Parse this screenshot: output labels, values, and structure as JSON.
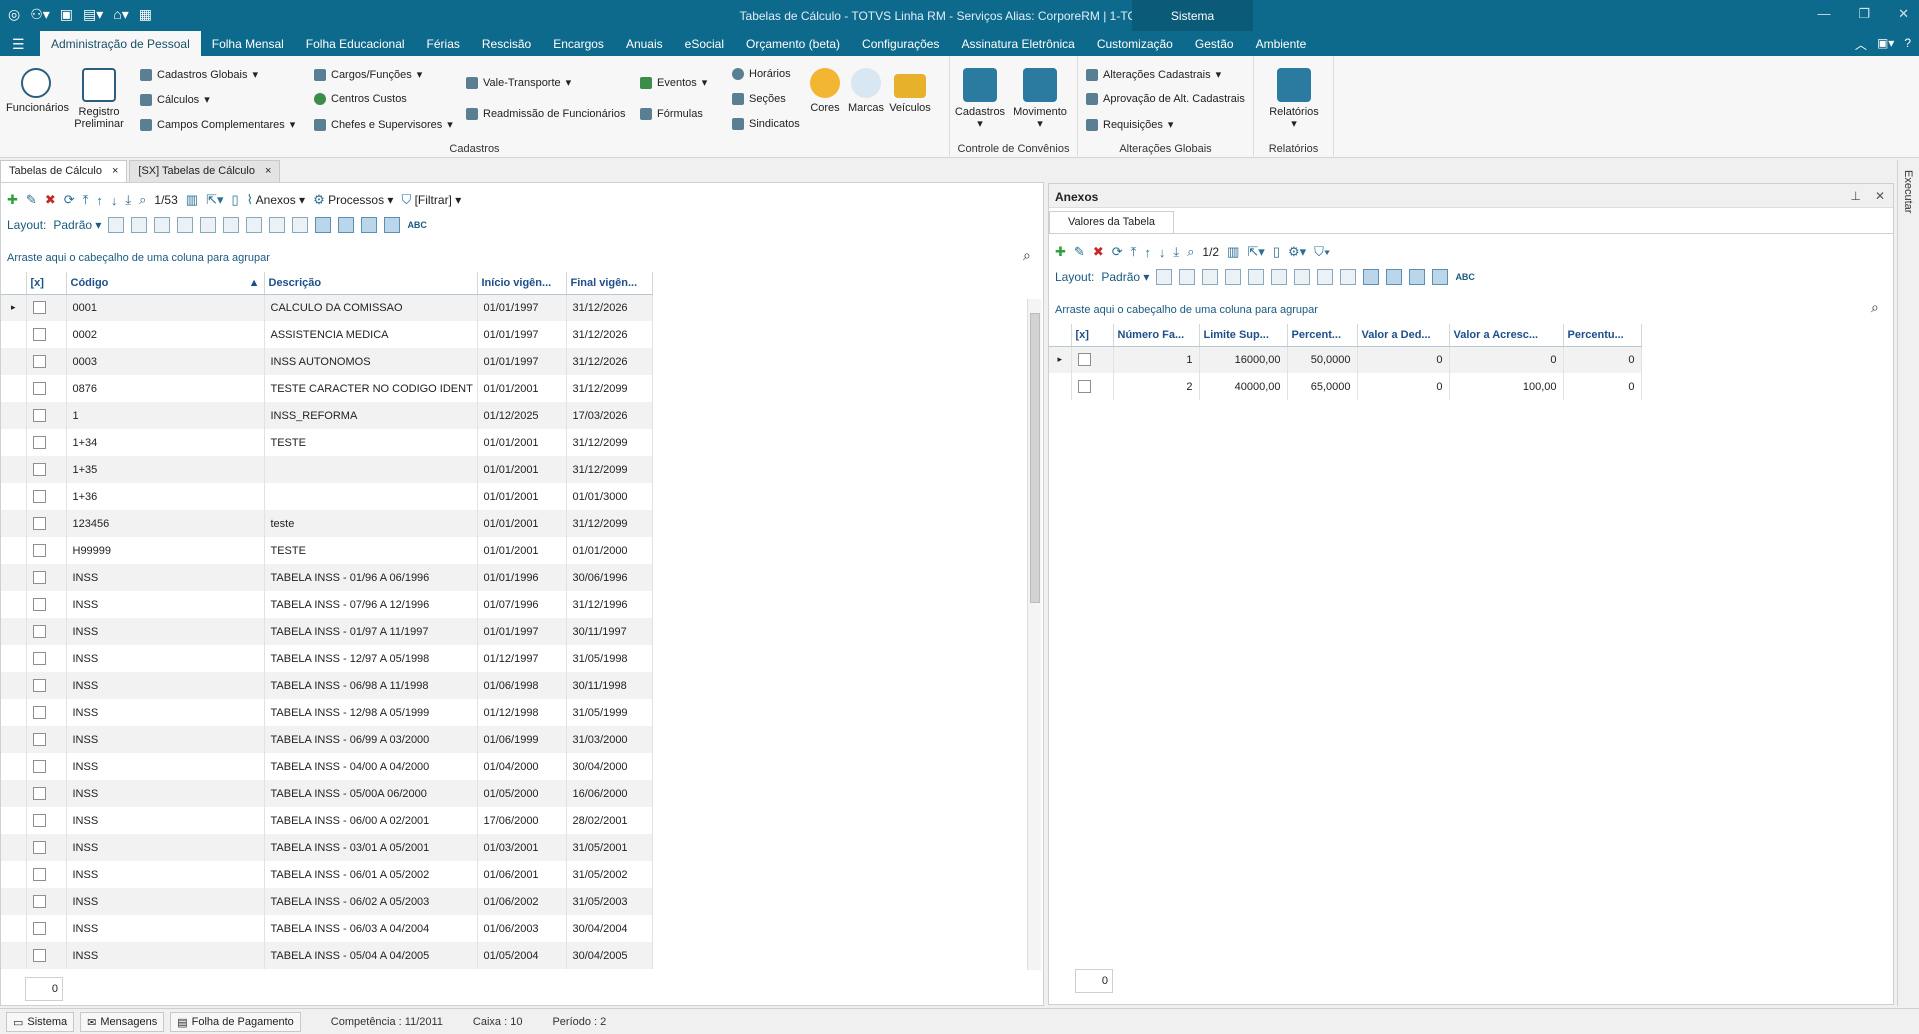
{
  "titlebar": {
    "title": "Tabelas de Cálculo - TOTVS Linha RM - Serviços  Alias: CorporeRM | 1-TOTVS SA",
    "system_tab": "Sistema"
  },
  "menu": {
    "tabs": [
      "Administração de Pessoal",
      "Folha Mensal",
      "Folha Educacional",
      "Férias",
      "Rescisão",
      "Encargos",
      "Anuais",
      "eSocial",
      "Orçamento (beta)",
      "Configurações",
      "Assinatura Eletrônica",
      "Customização",
      "Gestão",
      "Ambiente"
    ],
    "active_index": 0
  },
  "ribbon": {
    "cadastros": {
      "label": "Cadastros",
      "funcionarios": "Funcionários",
      "registro": "Registro Preliminar",
      "cadastros_globais": "Cadastros Globais",
      "calculos": "Cálculos",
      "campos_complementares": "Campos Complementares",
      "cargos": "Cargos/Funções",
      "centros_custos": "Centros Custos",
      "chefes": "Chefes e Supervisores",
      "vale_transporte": "Vale-Transporte",
      "readmissao": "Readmissão de Funcionários",
      "eventos": "Eventos",
      "formulas": "Fórmulas",
      "horarios": "Horários",
      "secoes": "Seções",
      "sindicatos": "Sindicatos",
      "cores": "Cores",
      "marcas": "Marcas",
      "veiculos": "Veículos"
    },
    "convenios": {
      "label": "Controle de Convênios",
      "cadastros": "Cadastros",
      "movimento": "Movimento"
    },
    "alteracoes": {
      "label": "Alterações Globais",
      "alteracoes_cadastrais": "Alterações Cadastrais",
      "aprovacao": "Aprovação de Alt. Cadastrais",
      "requisicoes": "Requisições"
    },
    "relatorios": {
      "label": "Relatórios",
      "button": "Relatórios"
    }
  },
  "doc_tabs": [
    "Tabelas de Cálculo",
    "[SX] Tabelas de Cálculo"
  ],
  "left": {
    "toolbar": {
      "page": "1/53",
      "anexos": "Anexos",
      "processos": "Processos",
      "filtrar": "[Filtrar]"
    },
    "layout_label": "Layout:",
    "layout_value": "Padrão",
    "group_hint": "Arraste aqui o cabeçalho de uma coluna para agrupar",
    "columns": [
      "[x]",
      "Código",
      "Descrição",
      "Início vigên...",
      "Final vigên..."
    ],
    "rows": [
      [
        "0001",
        "CALCULO DA COMISSAO",
        "01/01/1997",
        "31/12/2026"
      ],
      [
        "0002",
        "ASSISTENCIA MEDICA",
        "01/01/1997",
        "31/12/2026"
      ],
      [
        "0003",
        "INSS AUTONOMOS",
        "01/01/1997",
        "31/12/2026"
      ],
      [
        "0876",
        "TESTE CARACTER NO CODIGO IDENT",
        "01/01/2001",
        "31/12/2099"
      ],
      [
        "1",
        "INSS_REFORMA",
        "01/12/2025",
        "17/03/2026"
      ],
      [
        "1+34",
        "TESTE",
        "01/01/2001",
        "31/12/2099"
      ],
      [
        "1+35",
        "",
        "01/01/2001",
        "31/12/2099"
      ],
      [
        "1+36",
        "",
        "01/01/2001",
        "01/01/3000"
      ],
      [
        "123456",
        "teste",
        "01/01/2001",
        "31/12/2099"
      ],
      [
        "H99999",
        "TESTE",
        "01/01/2001",
        "01/01/2000"
      ],
      [
        "INSS",
        "TABELA INSS - 01/96 A 06/1996",
        "01/01/1996",
        "30/06/1996"
      ],
      [
        "INSS",
        "TABELA INSS - 07/96 A 12/1996",
        "01/07/1996",
        "31/12/1996"
      ],
      [
        "INSS",
        "TABELA INSS - 01/97 A 11/1997",
        "01/01/1997",
        "30/11/1997"
      ],
      [
        "INSS",
        "TABELA INSS - 12/97 A 05/1998",
        "01/12/1997",
        "31/05/1998"
      ],
      [
        "INSS",
        "TABELA INSS - 06/98 A 11/1998",
        "01/06/1998",
        "30/11/1998"
      ],
      [
        "INSS",
        "TABELA INSS - 12/98 A  05/1999",
        "01/12/1998",
        "31/05/1999"
      ],
      [
        "INSS",
        "TABELA INSS - 06/99 A 03/2000",
        "01/06/1999",
        "31/03/2000"
      ],
      [
        "INSS",
        "TABELA INSS - 04/00 A  04/2000",
        "01/04/2000",
        "30/04/2000"
      ],
      [
        "INSS",
        "TABELA INSS - 05/00A  06/2000",
        "01/05/2000",
        "16/06/2000"
      ],
      [
        "INSS",
        "TABELA INSS - 06/00 A 02/2001",
        "17/06/2000",
        "28/02/2001"
      ],
      [
        "INSS",
        "TABELA INSS - 03/01 A 05/2001",
        "01/03/2001",
        "31/05/2001"
      ],
      [
        "INSS",
        "TABELA INSS - 06/01 A 05/2002",
        "01/06/2001",
        "31/05/2002"
      ],
      [
        "INSS",
        "TABELA INSS - 06/02 A 05/2003",
        "01/06/2002",
        "31/05/2003"
      ],
      [
        "INSS",
        "TABELA INSS - 06/03 A 04/2004",
        "01/06/2003",
        "30/04/2004"
      ],
      [
        "INSS",
        "TABELA INSS - 05/04 A 04/2005",
        "01/05/2004",
        "30/04/2005"
      ]
    ],
    "count": "0"
  },
  "right": {
    "title": "Anexos",
    "tab": "Valores da Tabela",
    "toolbar": {
      "page": "1/2"
    },
    "layout_label": "Layout:",
    "layout_value": "Padrão",
    "group_hint": "Arraste aqui o cabeçalho de uma coluna para agrupar",
    "columns": [
      "[x]",
      "Número Fa...",
      "Limite Sup...",
      "Percent...",
      "Valor a Ded...",
      "Valor a Acresc...",
      "Percentu..."
    ],
    "rows": [
      [
        "1",
        "16000,00",
        "50,0000",
        "0",
        "0",
        "0"
      ],
      [
        "2",
        "40000,00",
        "65,0000",
        "0",
        "100,00",
        "0"
      ]
    ],
    "count": "0"
  },
  "sidebar_exec": "Executar",
  "status": {
    "sistema": "Sistema",
    "mensagens": "Mensagens",
    "folha": "Folha de Pagamento",
    "competencia": "Competência : 11/2011",
    "caixa": "Caixa : 10",
    "periodo": "Período : 2"
  }
}
